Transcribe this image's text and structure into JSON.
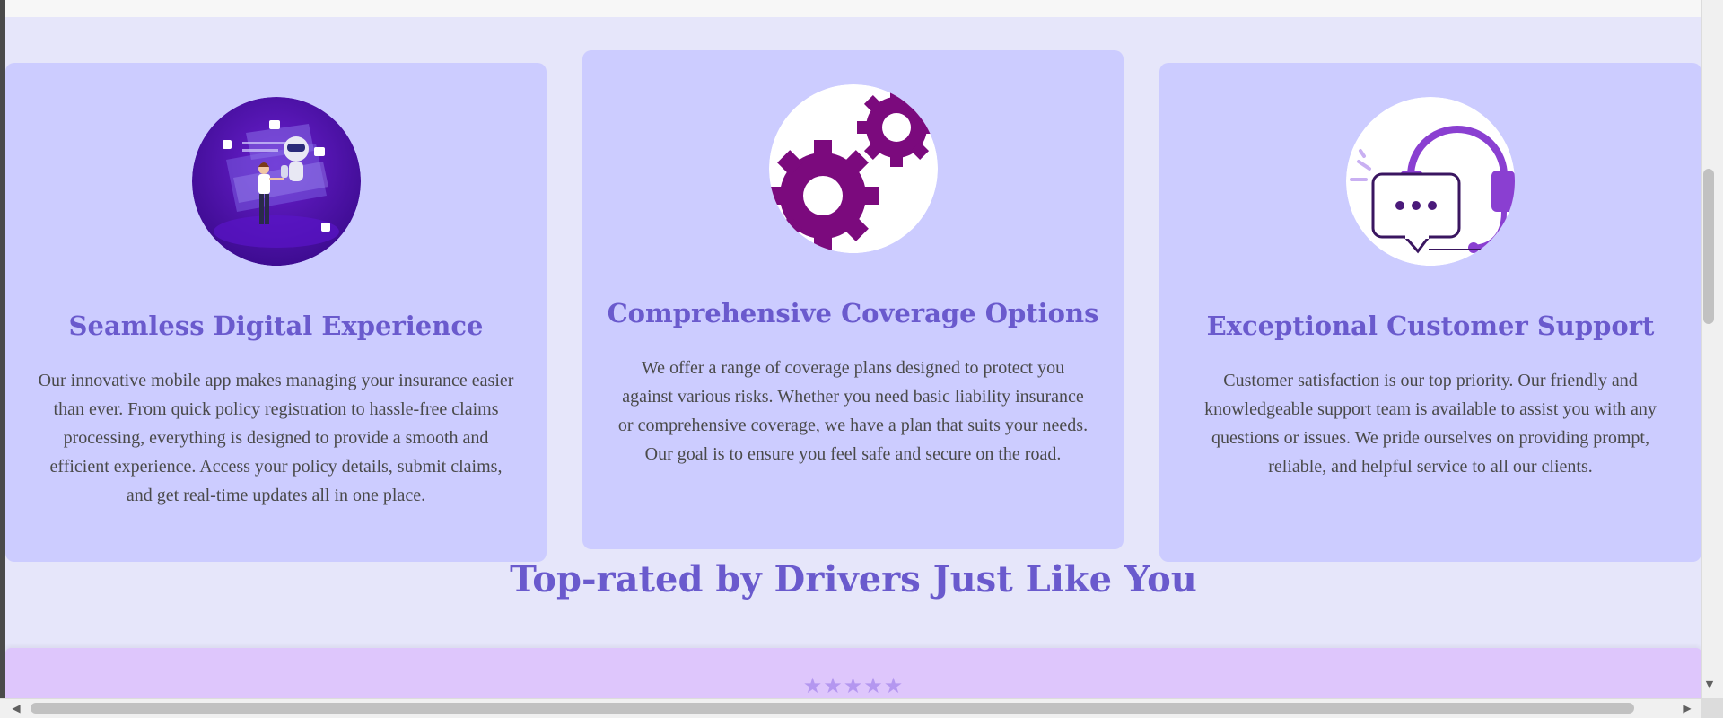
{
  "features": [
    {
      "title": "Seamless Digital Experience",
      "text": "Our innovative mobile app makes managing your insurance easier than ever. From quick policy registration to hassle-free claims processing, everything is designed to provide a smooth and efficient experience. Access your policy details, submit claims, and get real-time updates all in one place.",
      "icon": "robot-assistant-illustration"
    },
    {
      "title": "Comprehensive Coverage Options",
      "text": "We offer a range of coverage plans designed to protect you against various risks. Whether you need basic liability insurance or comprehensive coverage, we have a plan that suits your needs. Our goal is to ensure you feel safe and secure on the road.",
      "icon": "gears-icon"
    },
    {
      "title": "Exceptional Customer Support",
      "text": "Customer satisfaction is our top priority. Our friendly and knowledgeable support team is available to assist you with any questions or issues. We pride ourselves on providing prompt, reliable, and helpful service to all our clients.",
      "icon": "headset-chat-icon"
    }
  ],
  "testimonials": {
    "heading": "Top-rated by Drivers Just Like You",
    "stars": "★★★★★",
    "rating": 5
  },
  "colors": {
    "page_background": "#e6e6fa",
    "card_background": "#ccccff",
    "heading": "#6a5acd",
    "body_text": "#4a4a4a",
    "gear": "#7b0a7d",
    "headset": "#8a3fd1",
    "review_band": "#dec6fc",
    "stars": "#b497f0"
  }
}
